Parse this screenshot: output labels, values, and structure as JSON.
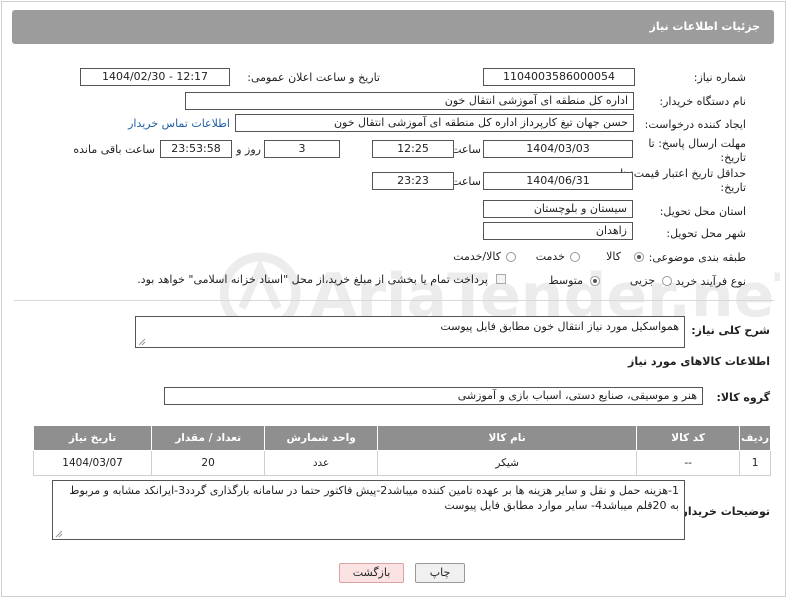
{
  "title": "جزئیات اطلاعات نیاز",
  "fields": {
    "need_number_label": "شماره نیاز:",
    "need_number": "1104003586000054",
    "announce_label": "تاریخ و ساعت اعلان عمومی:",
    "announce_value": "1404/02/30 - 12:17",
    "buyer_org_label": "نام دستگاه خریدار:",
    "buyer_org": "اداره کل منطقه ای آموزشی انتقال خون",
    "creator_label": "ایجاد کننده درخواست:",
    "creator": "حسن جهان تیغ کارپرداز اداره کل منطقه ای آموزشی انتقال خون",
    "contact_link": "اطلاعات تماس خریدار",
    "deadline_label": "مهلت ارسال پاسخ: تا تاریخ:",
    "deadline_date": "1404/03/03",
    "time_label": "ساعت",
    "deadline_time": "12:25",
    "days": "3",
    "days_label": "روز و",
    "remaining": "23:53:58",
    "remaining_label": "ساعت باقی مانده",
    "validity_label": "حداقل تاریخ اعتبار قیمت: تا تاریخ:",
    "validity_date": "1404/06/31",
    "validity_time": "23:23",
    "province_label": "استان محل تحویل:",
    "province": "سیستان و بلوچستان",
    "city_label": "شهر محل تحویل:",
    "city": "زاهدان",
    "category_label": "طبقه بندی موضوعی:",
    "category_options": [
      "کالا",
      "خدمت",
      "کالا/خدمت"
    ],
    "category_selected": "کالا",
    "process_label": "نوع فرآیند خرید :",
    "process_options": [
      "جزیی",
      "متوسط"
    ],
    "process_selected": "متوسط",
    "payment_note": "پرداخت تمام یا بخشی از مبلغ خرید،از محل \"اسناد خزانه اسلامی\" خواهد بود."
  },
  "description": {
    "label": "شرح کلی نیاز:",
    "value": "همواسکیل مورد نیاز انتقال خون مطابق فایل پیوست"
  },
  "goods_section": {
    "title": "اطلاعات کالاهای مورد نیاز",
    "group_label": "گروه کالا:",
    "group_value": "هنر و موسیقی، صنایع دستی، اسباب بازی و آموزشی"
  },
  "table": {
    "headers": [
      "ردیف",
      "کد کالا",
      "نام کالا",
      "واحد شمارش",
      "تعداد / مقدار",
      "تاریخ نیاز"
    ],
    "rows": [
      [
        "1",
        "--",
        "شیکر",
        "عدد",
        "20",
        "1404/03/07"
      ]
    ]
  },
  "buyer_notes": {
    "label": "توضیحات خریدار:",
    "value": "1-هزینه حمل و نقل و سایر هزینه ها  بر عهده تامین کننده  میباشد2-پیش فاکتور حتما در سامانه بارگذاری گردد3-ایرانکد مشابه و مربوط به 20قلم میباشد4- سایر موارد مطابق فایل پیوست"
  },
  "buttons": {
    "print": "چاپ",
    "back": "بازگشت"
  },
  "colors": {
    "header_bg": "#9c9c9c",
    "table_header_bg": "#8f8f8f",
    "link": "#1f5fa8",
    "back_button_bg": "#fbe3e3"
  }
}
